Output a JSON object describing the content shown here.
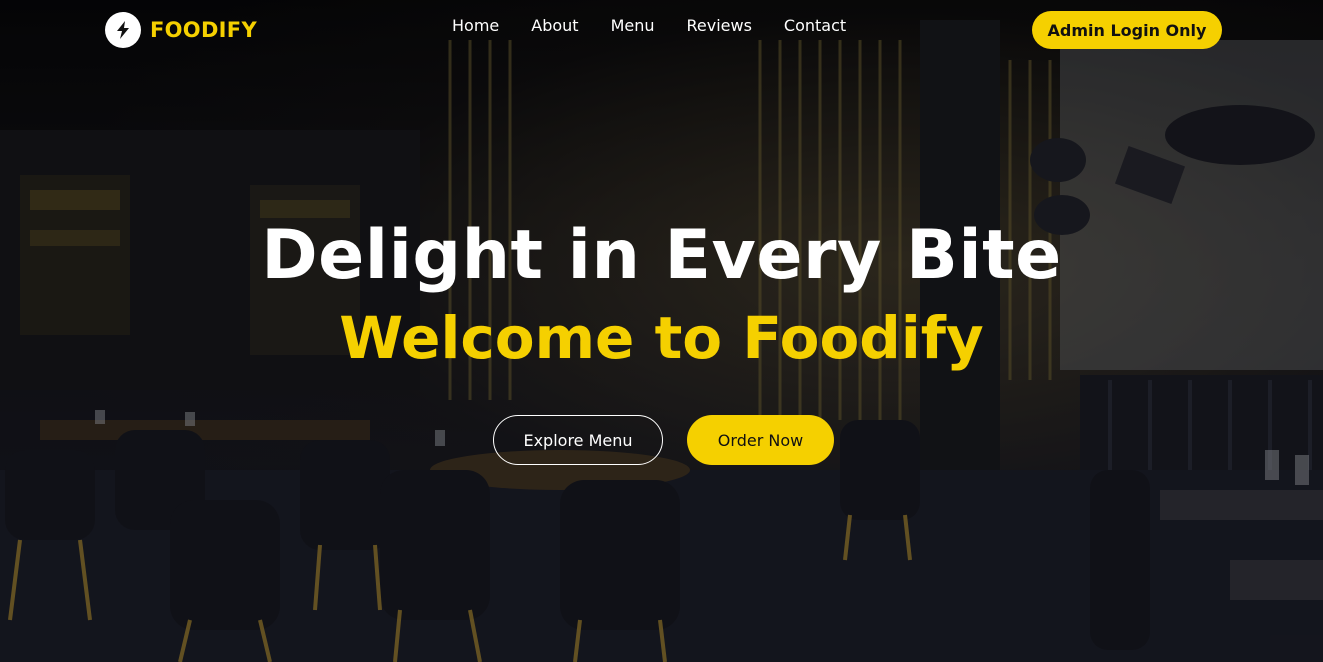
{
  "brand": {
    "name": "FOODIFY",
    "logo_icon": "bolt-icon",
    "accent_color": "#f5d000"
  },
  "nav": {
    "links": [
      "Home",
      "About",
      "Menu",
      "Reviews",
      "Contact"
    ],
    "admin_button": "Admin Login Only"
  },
  "hero": {
    "headline": "Delight in Every Bite",
    "subheadline": "Welcome to Foodify",
    "buttons": {
      "explore": "Explore Menu",
      "order": "Order Now"
    }
  }
}
